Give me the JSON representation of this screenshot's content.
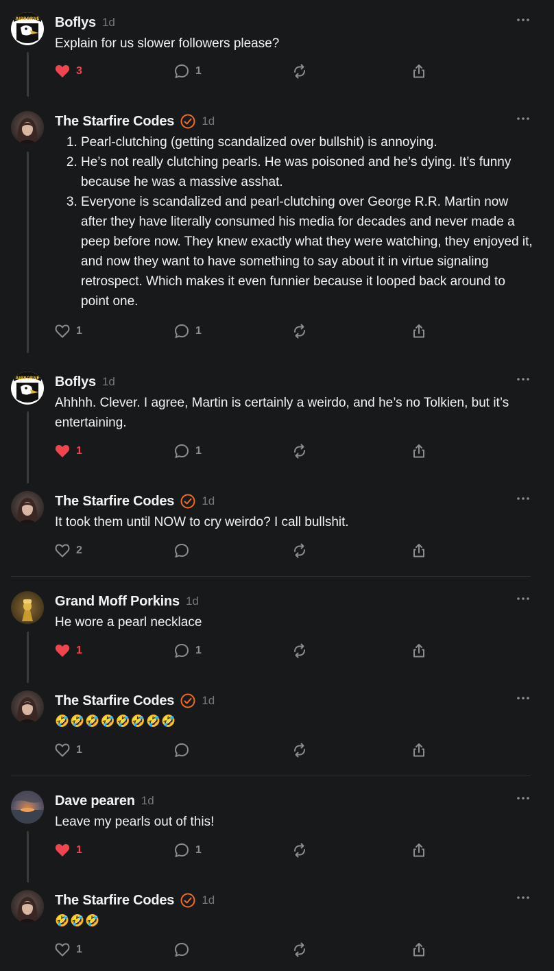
{
  "colors": {
    "background": "#18191b",
    "like_active": "#f0444f",
    "verified": "#f06c1e",
    "muted": "#77787c"
  },
  "posts": [
    {
      "author": "Boflys",
      "time": "1d",
      "verified": false,
      "avatar": "airborne-eagle-avatar",
      "text": "Explain for us slower followers please?",
      "liked": true,
      "likes": "3",
      "replies": "1"
    },
    {
      "author": "The Starfire Codes",
      "time": "1d",
      "verified": true,
      "avatar": "woman-portrait-avatar",
      "list": [
        "Pearl-clutching (getting scandalized over bullshit) is annoying.",
        "He’s not really clutching pearls. He was poisoned and he’s dying. It’s funny because he was a massive asshat.",
        "Everyone is scandalized and pearl-clutching over George R.R. Martin now after they have literally consumed his media for decades and never made a peep before now. They knew exactly what they were watching, they enjoyed it, and now they want to have something to say about it in virtue signaling retrospect. Which makes it even funnier because it looped back around to point one."
      ],
      "liked": false,
      "likes": "1",
      "replies": "1"
    },
    {
      "author": "Boflys",
      "time": "1d",
      "verified": false,
      "avatar": "airborne-eagle-avatar",
      "text": "Ahhhh. Clever. I agree, Martin is certainly a weirdo, and he’s no Tolkien, but it’s entertaining.",
      "liked": true,
      "likes": "1",
      "replies": "1"
    },
    {
      "author": "The Starfire Codes",
      "time": "1d",
      "verified": true,
      "avatar": "woman-portrait-avatar",
      "text": "It took them until NOW to cry weirdo? I call bullshit.",
      "liked": false,
      "likes": "2",
      "replies": ""
    },
    {
      "author": "Grand Moff Porkins",
      "time": "1d",
      "verified": false,
      "avatar": "golden-figure-avatar",
      "text": "He wore a pearl necklace",
      "liked": true,
      "likes": "1",
      "replies": "1"
    },
    {
      "author": "The Starfire Codes",
      "time": "1d",
      "verified": true,
      "avatar": "woman-portrait-avatar",
      "text": "🤣🤣🤣🤣🤣🤣🤣🤣",
      "liked": false,
      "likes": "1",
      "replies": ""
    },
    {
      "author": "Dave pearen",
      "time": "1d",
      "verified": false,
      "avatar": "sunset-sea-avatar",
      "text": "Leave my pearls out of this!",
      "liked": true,
      "likes": "1",
      "replies": "1"
    },
    {
      "author": "The Starfire Codes",
      "time": "1d",
      "verified": true,
      "avatar": "woman-portrait-avatar",
      "text": "🤣🤣🤣",
      "liked": false,
      "likes": "1",
      "replies": ""
    }
  ]
}
